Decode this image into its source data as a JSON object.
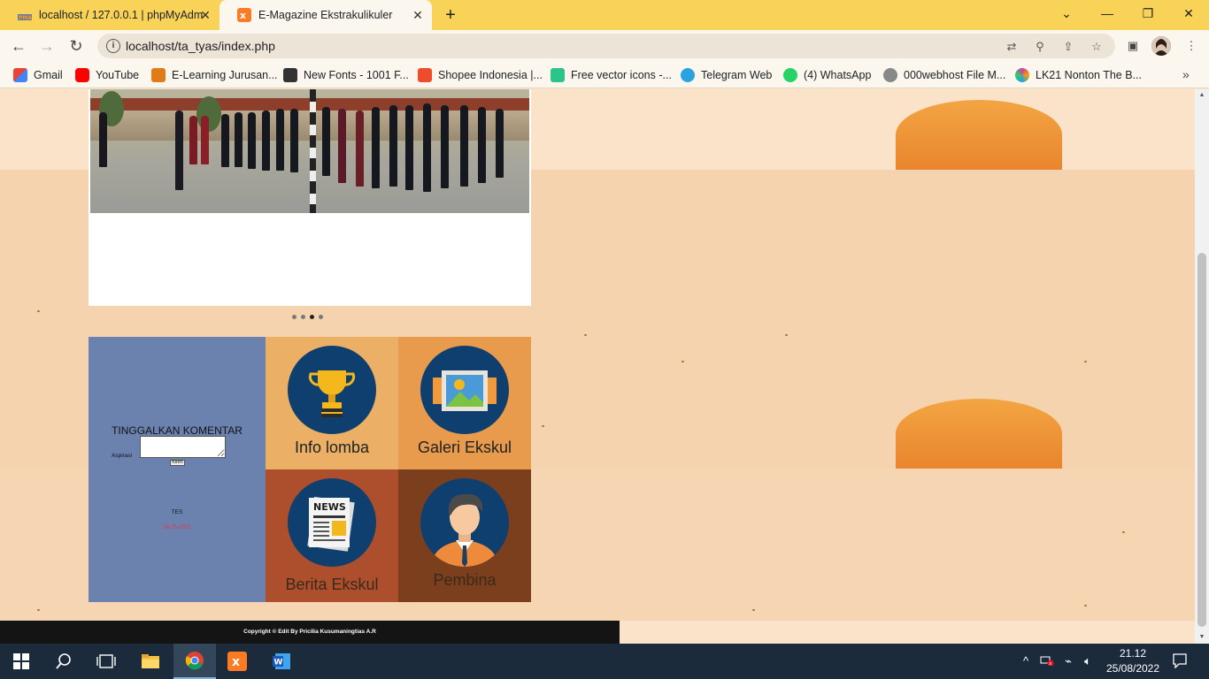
{
  "browser": {
    "tabs": [
      {
        "title": "localhost / 127.0.0.1 | phpMyAdm",
        "active": false
      },
      {
        "title": "E-Magazine Ekstrakulikuler",
        "active": true
      }
    ],
    "new_tab_label": "+",
    "url": "localhost/ta_tyas/index.php",
    "bookmarks": [
      {
        "label": "Gmail",
        "color": "#ea4335"
      },
      {
        "label": "YouTube",
        "color": "#ff0000"
      },
      {
        "label": "E-Learning Jurusan...",
        "color": "#e07b18"
      },
      {
        "label": "New Fonts - 1001 F...",
        "color": "#333333"
      },
      {
        "label": "Shopee Indonesia |...",
        "color": "#ee4d2d"
      },
      {
        "label": "Free vector icons -...",
        "color": "#2bc48a"
      },
      {
        "label": "Telegram Web",
        "color": "#2aa3df"
      },
      {
        "label": "(4) WhatsApp",
        "color": "#25d366"
      },
      {
        "label": "000webhost File M...",
        "color": "#888888"
      },
      {
        "label": "LK21 Nonton The B...",
        "color": "#d23ea8"
      }
    ]
  },
  "slider": {
    "dots": 4,
    "active_dot": 3
  },
  "comment": {
    "title": "TINGGALKAN KOMENTAR",
    "label": "Aspirasi",
    "submit": "Kirim",
    "entry_name": "TES",
    "entry_date": "08-25-2022"
  },
  "tiles": [
    {
      "label": "Info lomba",
      "icon": "trophy-icon"
    },
    {
      "label": "Galeri Ekskul",
      "icon": "gallery-icon"
    },
    {
      "label": "Berita Ekskul",
      "icon": "news-icon"
    },
    {
      "label": "Pembina",
      "icon": "person-icon"
    }
  ],
  "footer": {
    "text": "Copyright © Edit By Pricilia Kusumaningtias A.R"
  },
  "taskbar": {
    "time": "21.12",
    "date": "25/08/2022"
  }
}
